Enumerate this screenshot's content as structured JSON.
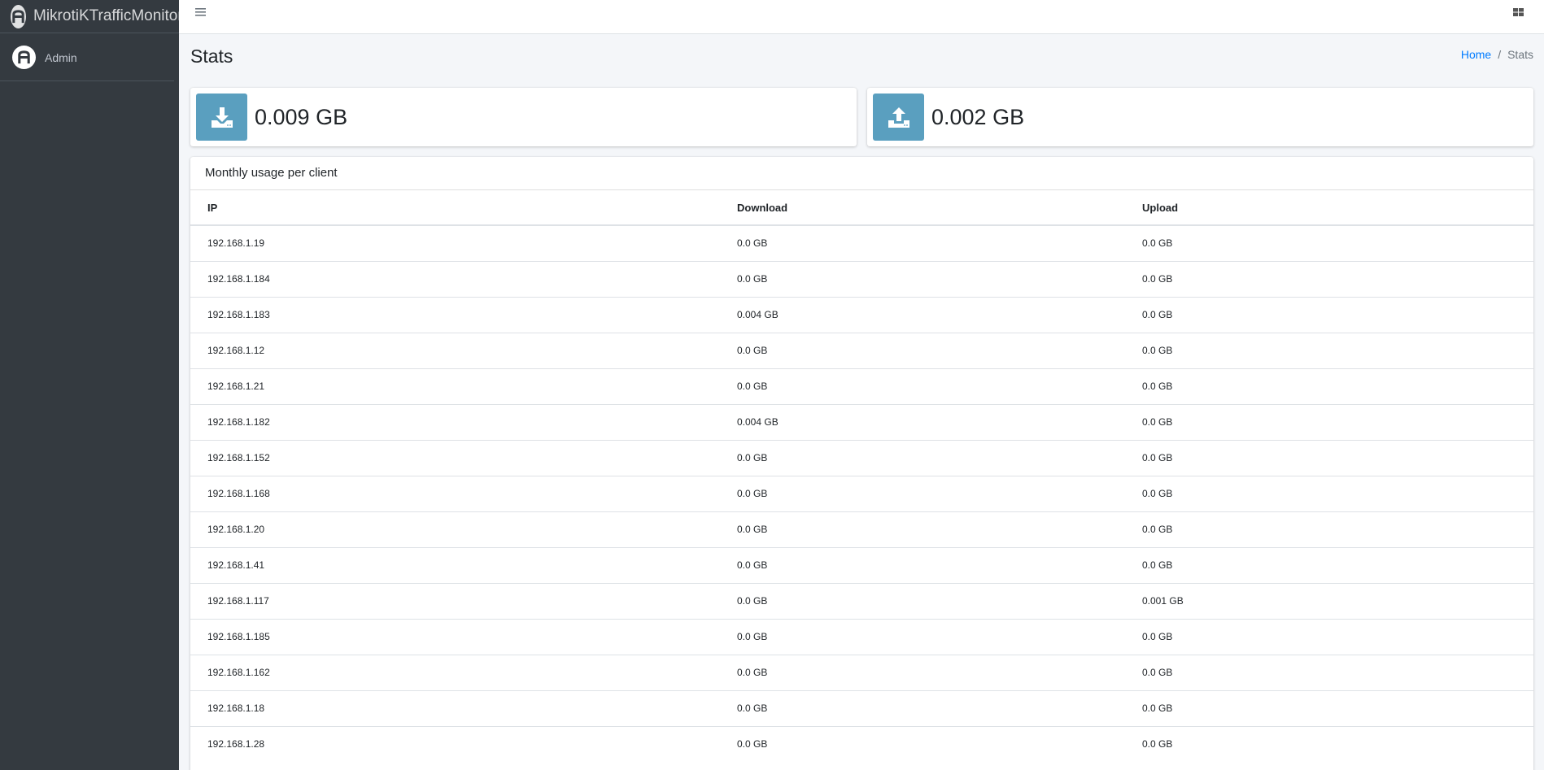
{
  "brand": {
    "title": "MikrotiKTrafficMonitor",
    "logo_icon": "brand-logo-icon"
  },
  "user": {
    "name": "Admin"
  },
  "navbar": {
    "menu_icon": "hamburger-icon",
    "apps_icon": "grid-icon"
  },
  "page": {
    "title": "Stats"
  },
  "breadcrumb": {
    "home": "Home",
    "separator": "/",
    "current": "Stats"
  },
  "totals": {
    "download": "0.009 GB",
    "upload": "0.002 GB"
  },
  "colors": {
    "sidebar": "#343a40",
    "info_icon_bg": "#5a9fbf",
    "link": "#007bff"
  },
  "table": {
    "title": "Monthly usage per client",
    "headers": [
      "IP",
      "Download",
      "Upload"
    ],
    "rows": [
      [
        "192.168.1.19",
        "0.0 GB",
        "0.0 GB"
      ],
      [
        "192.168.1.184",
        "0.0 GB",
        "0.0 GB"
      ],
      [
        "192.168.1.183",
        "0.004 GB",
        "0.0 GB"
      ],
      [
        "192.168.1.12",
        "0.0 GB",
        "0.0 GB"
      ],
      [
        "192.168.1.21",
        "0.0 GB",
        "0.0 GB"
      ],
      [
        "192.168.1.182",
        "0.004 GB",
        "0.0 GB"
      ],
      [
        "192.168.1.152",
        "0.0 GB",
        "0.0 GB"
      ],
      [
        "192.168.1.168",
        "0.0 GB",
        "0.0 GB"
      ],
      [
        "192.168.1.20",
        "0.0 GB",
        "0.0 GB"
      ],
      [
        "192.168.1.41",
        "0.0 GB",
        "0.0 GB"
      ],
      [
        "192.168.1.117",
        "0.0 GB",
        "0.001 GB"
      ],
      [
        "192.168.1.185",
        "0.0 GB",
        "0.0 GB"
      ],
      [
        "192.168.1.162",
        "0.0 GB",
        "0.0 GB"
      ],
      [
        "192.168.1.18",
        "0.0 GB",
        "0.0 GB"
      ],
      [
        "192.168.1.28",
        "0.0 GB",
        "0.0 GB"
      ]
    ]
  }
}
